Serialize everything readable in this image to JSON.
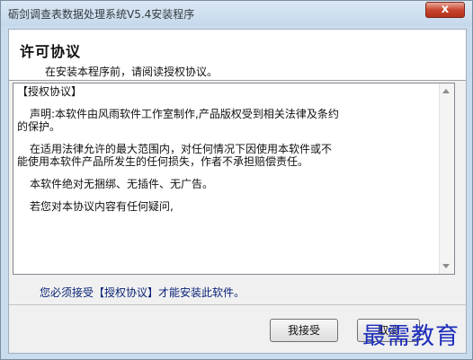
{
  "window": {
    "title": "砺剑调查表数据处理系统V5.4安装程序",
    "close_label": "x"
  },
  "header": {
    "title": "许可协议",
    "subtitle": "在安装本程序前，请阅读授权协议。"
  },
  "license": {
    "heading": "【授权协议】",
    "para1_line1": "声明:本软件由风雨软件工作室制作,产品版权受到相关法律及条约",
    "para1_line2": "的保护。",
    "para2_line1": "在适用法律允许的最大范围内，对任何情况下因使用本软件或不",
    "para2_line2": "能使用本软件产品所发生的任何损失，作者不承担赔偿责任。",
    "para3": "本软件绝对无捆绑、无插件、无广告。",
    "para4": "若您对本协议内容有任何疑问,"
  },
  "accept_note": "您必须接受【授权协议】才能安装此软件。",
  "buttons": {
    "accept": "我接受",
    "cancel": "取消"
  },
  "watermark": "最需教育",
  "icons": {
    "close": "close-icon",
    "scroll_up": "scroll-up-icon",
    "scroll_down": "scroll-down-icon"
  }
}
